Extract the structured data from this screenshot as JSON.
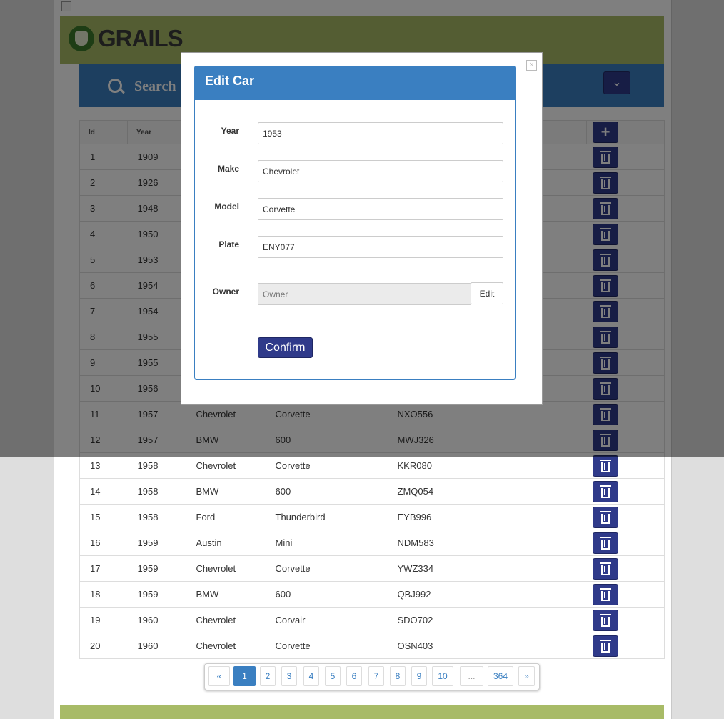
{
  "brand": {
    "name": "GRAILS"
  },
  "search": {
    "label": "Search"
  },
  "table": {
    "headers": [
      "Id",
      "Year"
    ],
    "rows": [
      {
        "id": "1",
        "year": "1909",
        "make": "",
        "model": "",
        "plate": ""
      },
      {
        "id": "2",
        "year": "1926",
        "make": "",
        "model": "",
        "plate": ""
      },
      {
        "id": "3",
        "year": "1948",
        "make": "",
        "model": "",
        "plate": ""
      },
      {
        "id": "4",
        "year": "1950",
        "make": "",
        "model": "",
        "plate": ""
      },
      {
        "id": "5",
        "year": "1953",
        "make": "",
        "model": "",
        "plate": ""
      },
      {
        "id": "6",
        "year": "1954",
        "make": "",
        "model": "",
        "plate": ""
      },
      {
        "id": "7",
        "year": "1954",
        "make": "",
        "model": "",
        "plate": ""
      },
      {
        "id": "8",
        "year": "1955",
        "make": "",
        "model": "",
        "plate": ""
      },
      {
        "id": "9",
        "year": "1955",
        "make": "",
        "model": "",
        "plate": ""
      },
      {
        "id": "10",
        "year": "1956",
        "make": "",
        "model": "",
        "plate": ""
      },
      {
        "id": "11",
        "year": "1957",
        "make": "Chevrolet",
        "model": "Corvette",
        "plate": "NXO556"
      },
      {
        "id": "12",
        "year": "1957",
        "make": "BMW",
        "model": "600",
        "plate": "MWJ326"
      },
      {
        "id": "13",
        "year": "1958",
        "make": "Chevrolet",
        "model": "Corvette",
        "plate": "KKR080"
      },
      {
        "id": "14",
        "year": "1958",
        "make": "BMW",
        "model": "600",
        "plate": "ZMQ054"
      },
      {
        "id": "15",
        "year": "1958",
        "make": "Ford",
        "model": "Thunderbird",
        "plate": "EYB996"
      },
      {
        "id": "16",
        "year": "1959",
        "make": "Austin",
        "model": "Mini",
        "plate": "NDM583"
      },
      {
        "id": "17",
        "year": "1959",
        "make": "Chevrolet",
        "model": "Corvette",
        "plate": "YWZ334"
      },
      {
        "id": "18",
        "year": "1959",
        "make": "BMW",
        "model": "600",
        "plate": "QBJ992"
      },
      {
        "id": "19",
        "year": "1960",
        "make": "Chevrolet",
        "model": "Corvair",
        "plate": "SDO702"
      },
      {
        "id": "20",
        "year": "1960",
        "make": "Chevrolet",
        "model": "Corvette",
        "plate": "OSN403"
      }
    ]
  },
  "pagination": {
    "prev": "«",
    "next": "»",
    "pages": [
      "1",
      "2",
      "3",
      "4",
      "5",
      "6",
      "7",
      "8",
      "9",
      "10",
      "...",
      "364"
    ],
    "current": "1"
  },
  "modal": {
    "title": "Edit Car",
    "close_glyph": "×",
    "fields": {
      "year": {
        "label": "Year",
        "value": "1953"
      },
      "make": {
        "label": "Make",
        "value": "Chevrolet"
      },
      "model": {
        "label": "Model",
        "value": "Corvette"
      },
      "plate": {
        "label": "Plate",
        "value": "ENY077"
      },
      "owner": {
        "label": "Owner",
        "placeholder": "Owner",
        "value": ""
      }
    },
    "owner_edit_label": "Edit",
    "confirm_label": "Confirm"
  },
  "colors": {
    "header_green": "#a8bb67",
    "primary_blue": "#3a7fc1",
    "button_navy": "#2f3a8a"
  },
  "icons": {
    "search": "search-icon",
    "dropdown": "chevron-down-icon",
    "add": "plus-icon",
    "delete": "trash-icon",
    "close": "close-icon"
  }
}
